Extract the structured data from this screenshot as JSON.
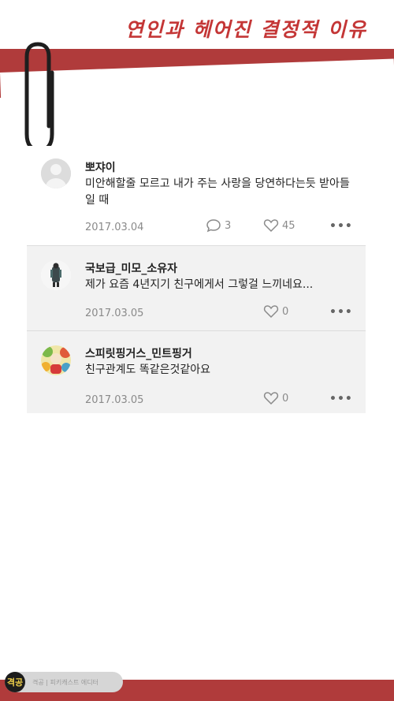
{
  "page": {
    "title": "연인과 헤어진 결정적 이유"
  },
  "comments": [
    {
      "author": "뽀쟈이",
      "text": "미안해할줄 모르고 내가 주는 사랑을 당연하다는듯 받아들일 때",
      "date": "2017.03.04",
      "replies": "3",
      "likes": "45",
      "avatar_icon": "default-user-icon"
    },
    {
      "author": "국보급_미모_소유자",
      "text": "제가 요즘 4년지기 친구에게서 그렇걸 느끼네요...",
      "date": "2017.03.05",
      "likes": "0",
      "avatar_icon": "photo-avatar-icon"
    },
    {
      "author": "스피릿핑거스_민트핑거",
      "text": "친구관계도 똑같은것같아요",
      "date": "2017.03.05",
      "likes": "0",
      "avatar_icon": "illustration-avatar-icon"
    }
  ],
  "badge": {
    "logo": "격공",
    "text": "격공 | 피키캐스트 에디터"
  },
  "colors": {
    "accent_red": "#b03b3b",
    "title_red": "#c43636"
  }
}
